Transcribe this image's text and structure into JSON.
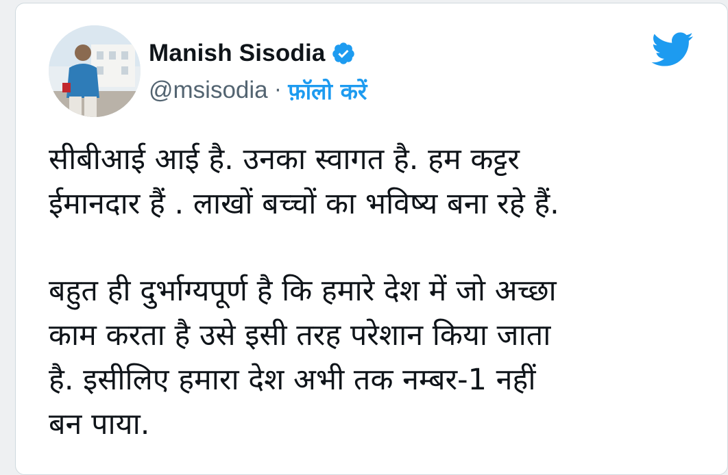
{
  "author": {
    "display_name": "Manish Sisodia",
    "handle": "@msisodia",
    "separator": "·",
    "follow_label": "फ़ॉलो करें",
    "verified": true
  },
  "icons": {
    "avatar": "profile-photo",
    "verified": "verified-badge-icon",
    "brand": "twitter-bird-icon"
  },
  "colors": {
    "accent": "#1d9bf0",
    "text": "#0f1419",
    "muted": "#536471"
  },
  "tweet": {
    "paragraphs": [
      "सीबीआई आई है. उनका स्वागत है. हम कट्टर\nईमानदार हैं . लाखों बच्चों का भविष्य बना रहे हैं.",
      "बहुत ही दुर्भाग्यपूर्ण है कि हमारे देश में जो अच्छा\nकाम करता है उसे इसी तरह परेशान किया जाता\nहै. इसीलिए हमारा देश अभी तक नम्बर-1 नहीं\nबन पाया."
    ]
  }
}
